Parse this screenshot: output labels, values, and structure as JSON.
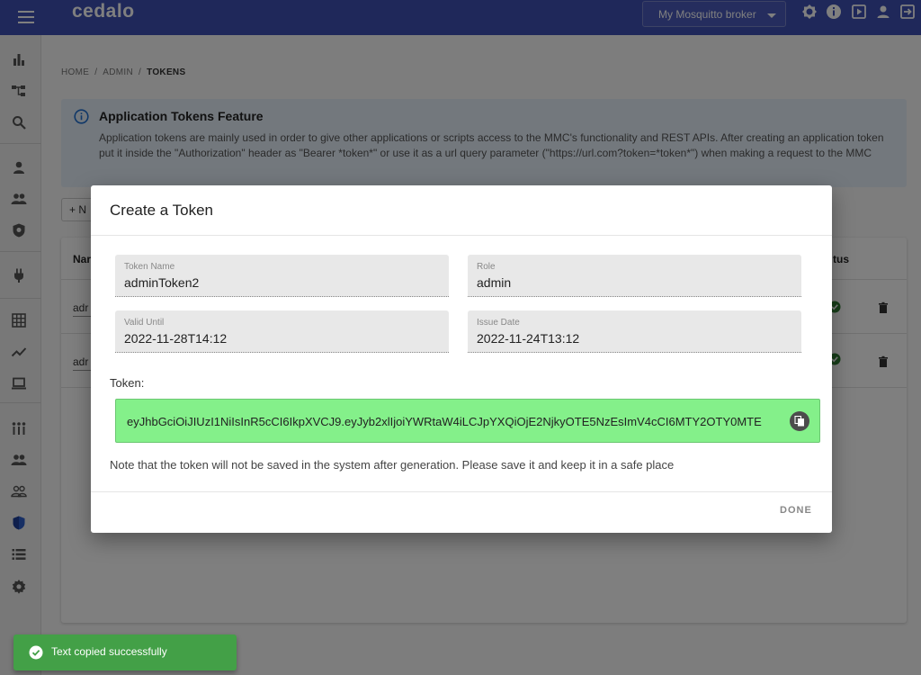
{
  "header": {
    "brand": "cedalo",
    "broker_select": "My Mosquitto broker",
    "icons": [
      "menu-icon",
      "theme-icon",
      "info-icon",
      "play-icon",
      "account-icon",
      "logout-icon"
    ]
  },
  "sidebar": {
    "icons": [
      "bar-chart-icon",
      "topology-icon",
      "search-icon",
      "person-icon",
      "group-icon",
      "shield-icon",
      "plug-icon",
      "grid-icon",
      "trend-icon",
      "laptop-icon",
      "streams-icon",
      "people-icon",
      "people-outline-icon",
      "security-icon",
      "list-icon",
      "settings-icon"
    ]
  },
  "breadcrumb": {
    "home": "HOME",
    "admin": "ADMIN",
    "current": "TOKENS"
  },
  "info_panel": {
    "title": "Application Tokens Feature",
    "text": "Application tokens are mainly used in order to give other applications or scripts access to the MMC's functionality and REST APIs. After creating an application token put it inside the \"Authorization\" header as \"Bearer *token*\" or use it as a url query parameter (\"https://url.com?token=*token*\") when making a request to the MMC"
  },
  "new_button": {
    "label": "+ N"
  },
  "table": {
    "col_name": "Nar",
    "col_status": "tus",
    "rows": [
      {
        "name": "adr"
      },
      {
        "name": "adr"
      }
    ]
  },
  "dialog": {
    "title": "Create a Token",
    "fields": {
      "token_name": {
        "label": "Token Name",
        "value": "adminToken2"
      },
      "role": {
        "label": "Role",
        "value": "admin"
      },
      "valid_until": {
        "label": "Valid Until",
        "value": "2022-11-28T14:12"
      },
      "issue_date": {
        "label": "Issue Date",
        "value": "2022-11-24T13:12"
      }
    },
    "token_label": "Token:",
    "token_value": "eyJhbGciOiJIUzI1NiIsInR5cCI6IkpXVCJ9.eyJyb2xlIjoiYWRtaW4iLCJpYXQiOjE2NjkyOTE5NzEsImV4cCI6MTY2OTY0MTE",
    "note": "Note that the token will not be saved in the system after generation. Please save it and keep it in a safe place",
    "done_label": "DONE"
  },
  "snackbar": {
    "message": "Text copied successfully"
  },
  "colors": {
    "header": "#3f51b5",
    "token_bg": "#84f08a",
    "snackbar": "#43a047",
    "info_bg": "#e6f0fb"
  }
}
